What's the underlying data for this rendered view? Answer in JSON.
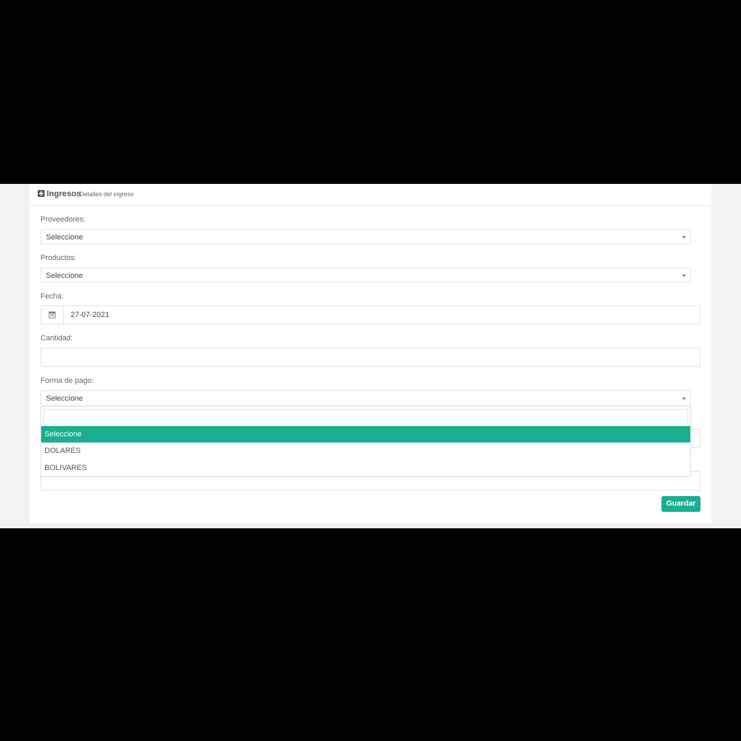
{
  "header": {
    "title": "Ingresos",
    "subtitle": "Detalles del ingreso"
  },
  "form": {
    "proveedores": {
      "label": "Proveedores:",
      "value": "Seleccione"
    },
    "productos": {
      "label": "Productos:",
      "value": "Seleccione"
    },
    "fecha": {
      "label": "Fecha:",
      "value": "27-07-2021"
    },
    "cantidad": {
      "label": "Cantidad:",
      "value": ""
    },
    "forma_pago": {
      "label": "Forma de pago:",
      "value": "Seleccione",
      "search_value": "",
      "options": [
        "Seleccione",
        "DOLARES",
        "BOLIVARES"
      ],
      "highlighted": "Seleccione"
    }
  },
  "actions": {
    "save_label": "Guardar"
  },
  "colors": {
    "accent": "#1bae91",
    "background": "#f2f2f2",
    "panel": "#ffffff"
  },
  "icons": {
    "header": "plus-square-icon",
    "date": "calendar-icon"
  }
}
